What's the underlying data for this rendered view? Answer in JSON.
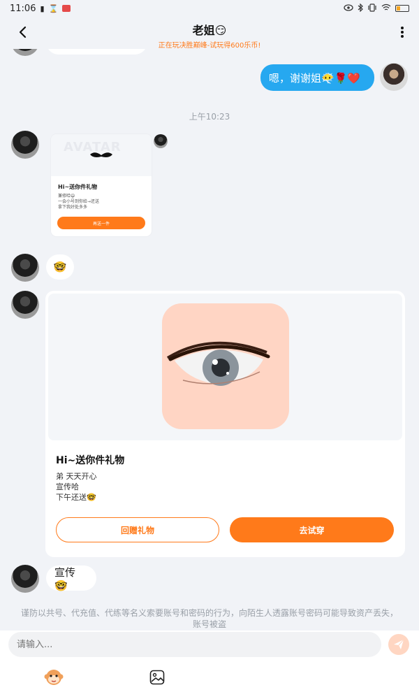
{
  "status_bar": {
    "time": "11:06",
    "icons_left": [
      "sim-icon",
      "hourglass-icon",
      "app-notification-icon"
    ],
    "icons_right": [
      "eye-icon",
      "bluetooth-icon",
      "vibrate-icon",
      "wifi-icon",
      "battery-icon"
    ]
  },
  "header": {
    "title": "老姐😏",
    "subtitle": "正在玩决胜巅峰-试玩得600乐币!",
    "back_icon": "chevron-left-icon",
    "more_icon": "more-vertical-icon"
  },
  "messages": {
    "mine_reply": "嗯，谢谢姐😶‍🌫️🌹❤️",
    "time_label": "上午10:23",
    "small_card": {
      "watermark": "AVATAR",
      "title": "Hi~送你件礼物",
      "text": "兼修哈😄\n一会小号到你给→还送\n拿下我好处多多",
      "button": "再送一件"
    },
    "emoji_message": "🤓",
    "big_card": {
      "title": "Hi~送你件礼物",
      "text_lines": [
        "弟 天天开心",
        "宣传哈",
        "下午还送🤓"
      ],
      "btn_return": "回赠礼物",
      "btn_try": "去试穿"
    },
    "last_message": "宣传🤓"
  },
  "notice": "谨防以共号、代充值、代练等名义索要账号和密码的行为，向陌生人透露账号密码可能导致资产丢失，账号被盗",
  "input": {
    "placeholder": "请输入...",
    "send_icon": "send-icon",
    "tools": [
      "monkey-emoji-icon",
      "image-icon"
    ]
  },
  "colors": {
    "accent_orange": "#ff7a1a",
    "my_bubble_blue": "#26a8f0",
    "background": "#f1f3f7"
  }
}
